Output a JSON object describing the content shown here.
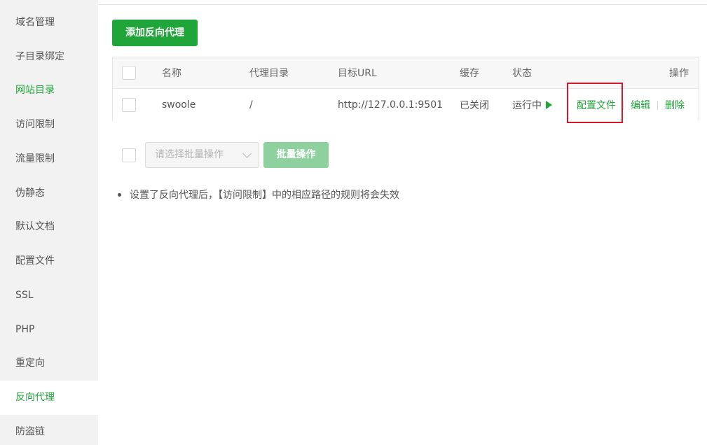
{
  "sidebar": {
    "items": [
      {
        "label": "域名管理"
      },
      {
        "label": "子目录绑定"
      },
      {
        "label": "网站目录"
      },
      {
        "label": "访问限制"
      },
      {
        "label": "流量限制"
      },
      {
        "label": "伪静态"
      },
      {
        "label": "默认文档"
      },
      {
        "label": "配置文件"
      },
      {
        "label": "SSL"
      },
      {
        "label": "PHP"
      },
      {
        "label": "重定向"
      },
      {
        "label": "反向代理"
      },
      {
        "label": "防盗链"
      }
    ],
    "active": "反向代理"
  },
  "toolbar": {
    "add_label": "添加反向代理"
  },
  "table": {
    "headers": {
      "name": "名称",
      "dir": "代理目录",
      "url": "目标URL",
      "cache": "缓存",
      "status": "状态",
      "ops": "操作"
    },
    "rows": [
      {
        "name": "swoole",
        "dir": "/",
        "url": "http://127.0.0.1:9501",
        "cache": "已关闭",
        "status": "运行中",
        "ops": [
          "配置文件",
          "编辑",
          "删除"
        ]
      }
    ]
  },
  "batch": {
    "select_placeholder": "请选择批量操作",
    "button_label": "批量操作"
  },
  "notes": [
    "设置了反向代理后，【访问限制】中的相应路径的规则将会失效"
  ],
  "colors": {
    "brand": "#20a53a",
    "danger": "#e11d1d",
    "highlight": "#d6182a"
  }
}
